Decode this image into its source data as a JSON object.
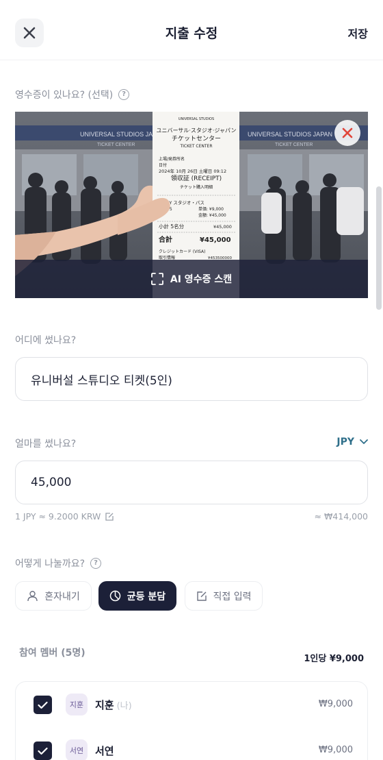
{
  "header": {
    "title": "지출 수정",
    "save_label": "저장"
  },
  "receipt": {
    "label": "영수증이 있나요? (선택)",
    "help_glyph": "?",
    "scan_label": "AI 영수증 스캔",
    "photo": {
      "brand": "UNIVERSAL STUDIOS",
      "sign_left": "UNIVERSAL STUDIOS JAPAN",
      "sign_right": "UNIVERSAL STUDIOS JAPAN",
      "sub_left": "TICKET CENTER",
      "sub_right": "TICKET CENTER",
      "line1": "ユニバーサル·スタジオ·ジャパン",
      "line2": "チケットセンター",
      "line3": "TICKET CENTER",
      "line4": "上場/発券所名",
      "line5": "日付",
      "line6": "2024年 10月 26日 土曜日 09:12",
      "line7": "領収証 (RECEIPT)",
      "line8": "チケット購入明細",
      "line9": "1-DAY スタジオ・パス",
      "line10": "数量: 5",
      "line11": "単価: ¥9,000",
      "line12": "金額: ¥45,000",
      "line13": "小計 5名分",
      "line14": "¥45,000",
      "line15": "合計",
      "line16": "¥45,000",
      "line17": "クレジットカード (VISA)",
      "line18": "取引情報",
      "line19": "¥453500000"
    }
  },
  "where": {
    "label": "어디에 썼나요?",
    "value": "유니버설 스튜디오 티켓(5인)"
  },
  "amount": {
    "label": "얼마를 썼나요?",
    "currency": "JPY",
    "value": "45,000",
    "rate": "1 JPY ≈ 9.2000 KRW",
    "converted": "≈ ₩414,000"
  },
  "split": {
    "label": "어떻게 나눌까요?",
    "help_glyph": "?",
    "options": [
      {
        "label": "혼자내기",
        "icon": "user-icon"
      },
      {
        "label": "균등 분담",
        "icon": "pie-chart-icon"
      },
      {
        "label": "직접 입력",
        "icon": "edit-icon"
      }
    ],
    "selected": "균등 분담"
  },
  "members": {
    "label": "참여 멤버 (5명)",
    "per_person": "1인당 ¥9,000",
    "list": [
      {
        "avatar": "지훈",
        "name": "지훈",
        "tag": "(나)",
        "amount": "₩9,000",
        "checked": true
      },
      {
        "avatar": "서연",
        "name": "서연",
        "tag": "",
        "amount": "₩9,000",
        "checked": true
      }
    ]
  },
  "colors": {
    "primary_dark": "#1c2038",
    "accent_currency": "#2f6f8a",
    "remove_icon": "#e0453a"
  }
}
